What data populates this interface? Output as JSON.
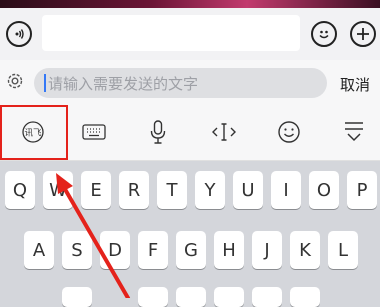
{
  "input": {
    "placeholder": "请输入需要发送的文字",
    "cancel_label": "取消"
  },
  "toolbar": {
    "handwriting_label": "讯飞"
  },
  "keyboard": {
    "row1": [
      "Q",
      "W",
      "E",
      "R",
      "T",
      "Y",
      "U",
      "I",
      "O",
      "P"
    ],
    "row2": [
      "A",
      "S",
      "D",
      "F",
      "G",
      "H",
      "J",
      "K",
      "L"
    ]
  },
  "colors": {
    "highlight": "#e4221b",
    "cursor": "#3478f6"
  }
}
